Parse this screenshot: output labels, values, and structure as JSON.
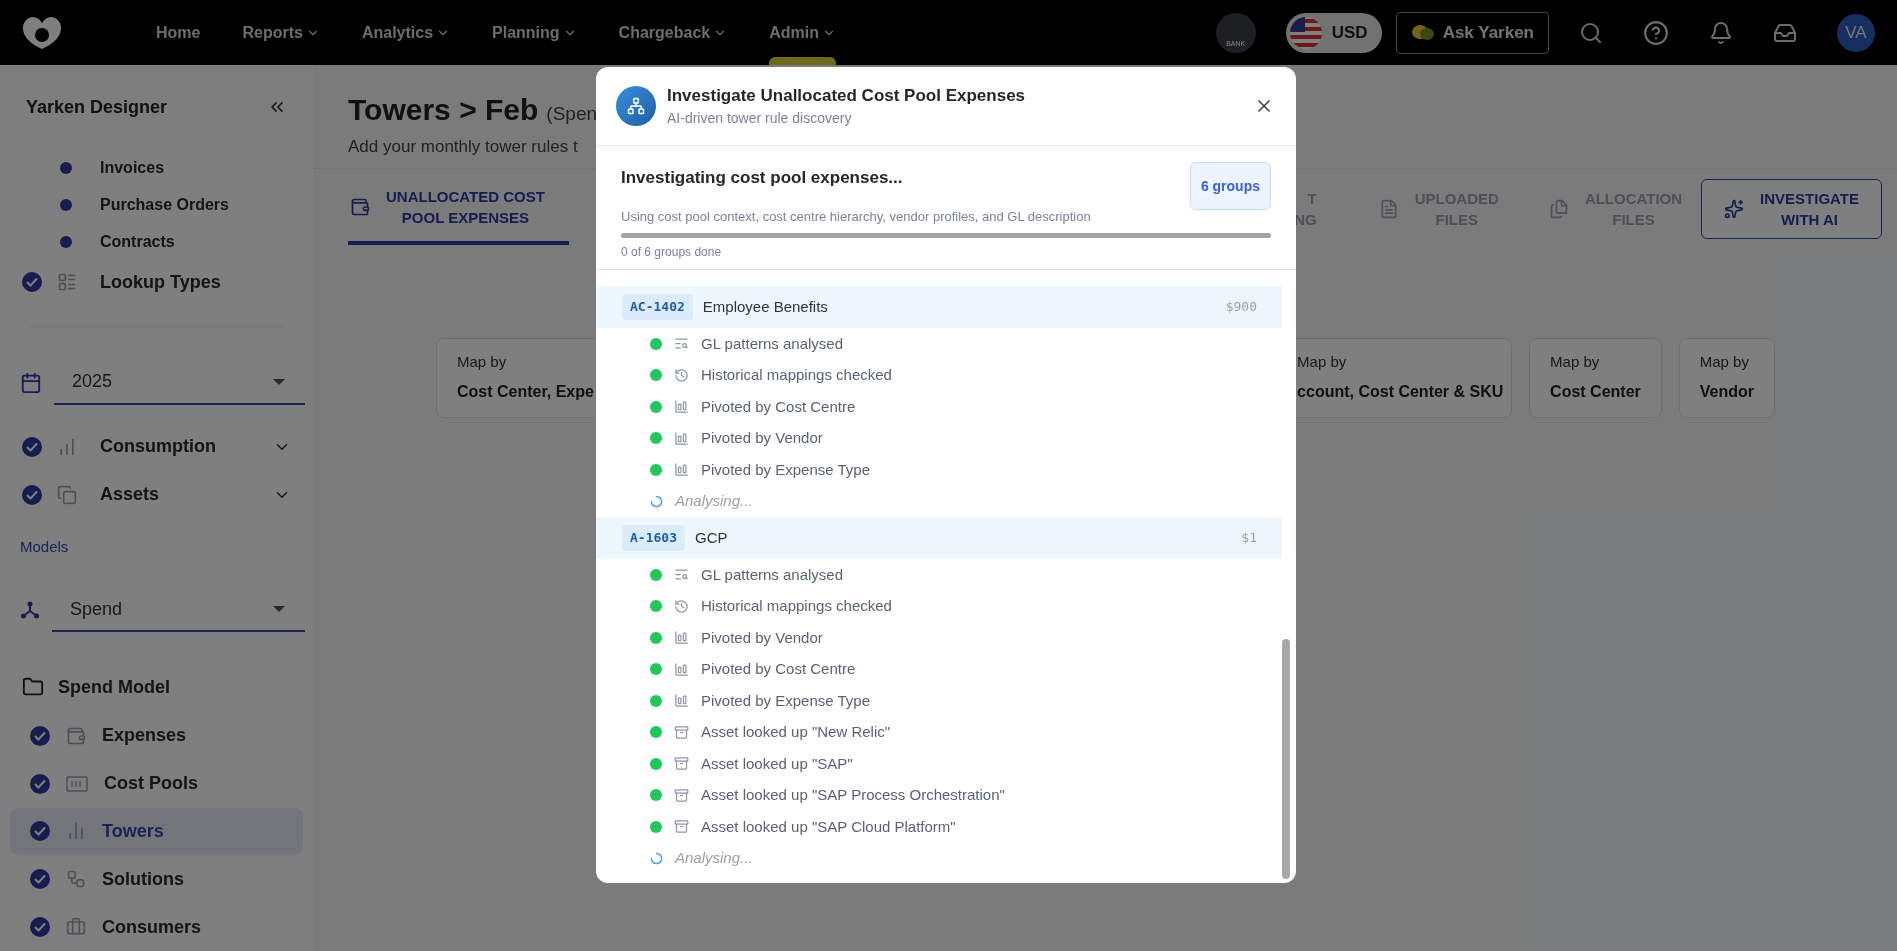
{
  "topbar": {
    "nav": [
      {
        "label": "Home",
        "dropdown": false,
        "selected": false
      },
      {
        "label": "Reports",
        "dropdown": true,
        "selected": false
      },
      {
        "label": "Analytics",
        "dropdown": true,
        "selected": false
      },
      {
        "label": "Planning",
        "dropdown": true,
        "selected": false
      },
      {
        "label": "Chargeback",
        "dropdown": true,
        "selected": false
      },
      {
        "label": "Admin",
        "dropdown": true,
        "selected": true
      }
    ],
    "bank_badge": "BANK",
    "currency": "USD",
    "ask_button": "Ask Yarken",
    "avatar": "VA"
  },
  "sidebar": {
    "title": "Yarken Designer",
    "items": [
      {
        "kind": "dot",
        "label": "Invoices"
      },
      {
        "kind": "dot",
        "label": "Purchase Orders"
      },
      {
        "kind": "dot",
        "label": "Contracts"
      },
      {
        "kind": "check",
        "label": "Lookup Types"
      },
      {
        "kind": "divider"
      },
      {
        "kind": "select",
        "value": "2025"
      },
      {
        "kind": "section",
        "label": "Consumption",
        "expanded": false
      },
      {
        "kind": "section",
        "label": "Assets",
        "expanded": false
      },
      {
        "kind": "heading",
        "label": "Models"
      },
      {
        "kind": "select",
        "value": "Spend"
      },
      {
        "kind": "folder",
        "label": "Spend Model"
      },
      {
        "kind": "model_item",
        "label": "Expenses",
        "selected": false
      },
      {
        "kind": "model_item",
        "label": "Cost Pools",
        "selected": false
      },
      {
        "kind": "model_item",
        "label": "Towers",
        "selected": true
      },
      {
        "kind": "model_item",
        "label": "Solutions",
        "selected": false
      },
      {
        "kind": "model_item",
        "label": "Consumers",
        "selected": false
      }
    ]
  },
  "page": {
    "title": "Towers > Feb",
    "title_note": "(Spen",
    "subtitle": "Add your monthly tower rules t",
    "tabs": [
      {
        "kind": "pool",
        "lines": [
          "UNALLOCATED COST",
          "POOL EXPENSES"
        ],
        "selected": true
      },
      {
        "kind": "partial",
        "lines": [
          "T",
          "NG"
        ],
        "selected": false
      },
      {
        "kind": "uploaded",
        "lines": [
          "UPLOADED",
          "FILES"
        ],
        "selected": false
      },
      {
        "kind": "allocation",
        "lines": [
          "ALLOCATION",
          "FILES"
        ],
        "selected": false
      }
    ],
    "investigate_button": [
      "INVESTIGATE",
      "WITH AI"
    ],
    "map_cards": [
      {
        "caption": "Map by",
        "value": "Cost Center, Expe"
      },
      {
        "caption": "Map by",
        "value": "ccount, Cost Center & SKU"
      },
      {
        "caption": "Map by",
        "value": "Cost Center"
      },
      {
        "caption": "Map by",
        "value": "Vendor"
      }
    ]
  },
  "modal": {
    "title": "Investigate Unallocated Cost Pool Expenses",
    "subtitle": "AI-driven tower rule discovery",
    "progress": {
      "title": "Investigating cost pool expenses...",
      "description": "Using cost pool context, cost centre hierarchy, vendor profiles, and GL description",
      "badge": "6 groups",
      "level": 0,
      "caption": "0 of 6 groups done"
    },
    "groups": [
      {
        "code": "AC-1402",
        "name": "Employee Benefits",
        "amount": "$900",
        "steps": [
          {
            "kind": "patterns",
            "done": true,
            "label": "GL patterns analysed"
          },
          {
            "kind": "history",
            "done": true,
            "label": "Historical mappings checked"
          },
          {
            "kind": "pivot",
            "done": true,
            "label": "Pivoted by Cost Centre"
          },
          {
            "kind": "pivot",
            "done": true,
            "label": "Pivoted by Vendor"
          },
          {
            "kind": "pivot",
            "done": true,
            "label": "Pivoted by Expense Type"
          },
          {
            "kind": "pending",
            "done": false,
            "label": "Analysing..."
          }
        ]
      },
      {
        "code": "A-1603",
        "name": "GCP",
        "amount": "$1",
        "steps": [
          {
            "kind": "patterns",
            "done": true,
            "label": "GL patterns analysed"
          },
          {
            "kind": "history",
            "done": true,
            "label": "Historical mappings checked"
          },
          {
            "kind": "pivot",
            "done": true,
            "label": "Pivoted by Vendor"
          },
          {
            "kind": "pivot",
            "done": true,
            "label": "Pivoted by Cost Centre"
          },
          {
            "kind": "pivot",
            "done": true,
            "label": "Pivoted by Expense Type"
          },
          {
            "kind": "asset",
            "done": true,
            "label": "Asset looked up \"New Relic\""
          },
          {
            "kind": "asset",
            "done": true,
            "label": "Asset looked up \"SAP\""
          },
          {
            "kind": "asset",
            "done": true,
            "label": "Asset looked up \"SAP Process Orchestration\""
          },
          {
            "kind": "asset",
            "done": true,
            "label": "Asset looked up \"SAP Cloud Platform\""
          },
          {
            "kind": "pending",
            "done": false,
            "label": "Analysing..."
          }
        ]
      }
    ]
  }
}
